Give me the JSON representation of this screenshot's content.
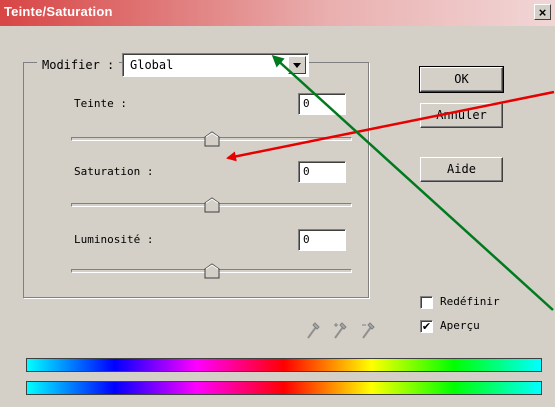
{
  "window": {
    "title": "Teinte/Saturation",
    "close_glyph": "×"
  },
  "modify": {
    "label": "Modifier :",
    "value": "Global"
  },
  "sliders": [
    {
      "label": "Teinte :",
      "value": "0",
      "position": 0.5
    },
    {
      "label": "Saturation :",
      "value": "0",
      "position": 0.5
    },
    {
      "label": "Luminosité :",
      "value": "0",
      "position": 0.5
    }
  ],
  "buttons": {
    "ok": "OK",
    "cancel": "Annuler",
    "help": "Aide"
  },
  "checkboxes": [
    {
      "label": "Redéfinir",
      "checked": false,
      "mark": ""
    },
    {
      "label": "Aperçu",
      "checked": true,
      "mark": "✔"
    }
  ],
  "annotations": {
    "red_arrow_color": "#e60000",
    "green_arrow_color": "#007a1e"
  },
  "icons": [
    "eyedropper-icon",
    "eyedropper-plus-icon",
    "eyedropper-minus-icon"
  ]
}
